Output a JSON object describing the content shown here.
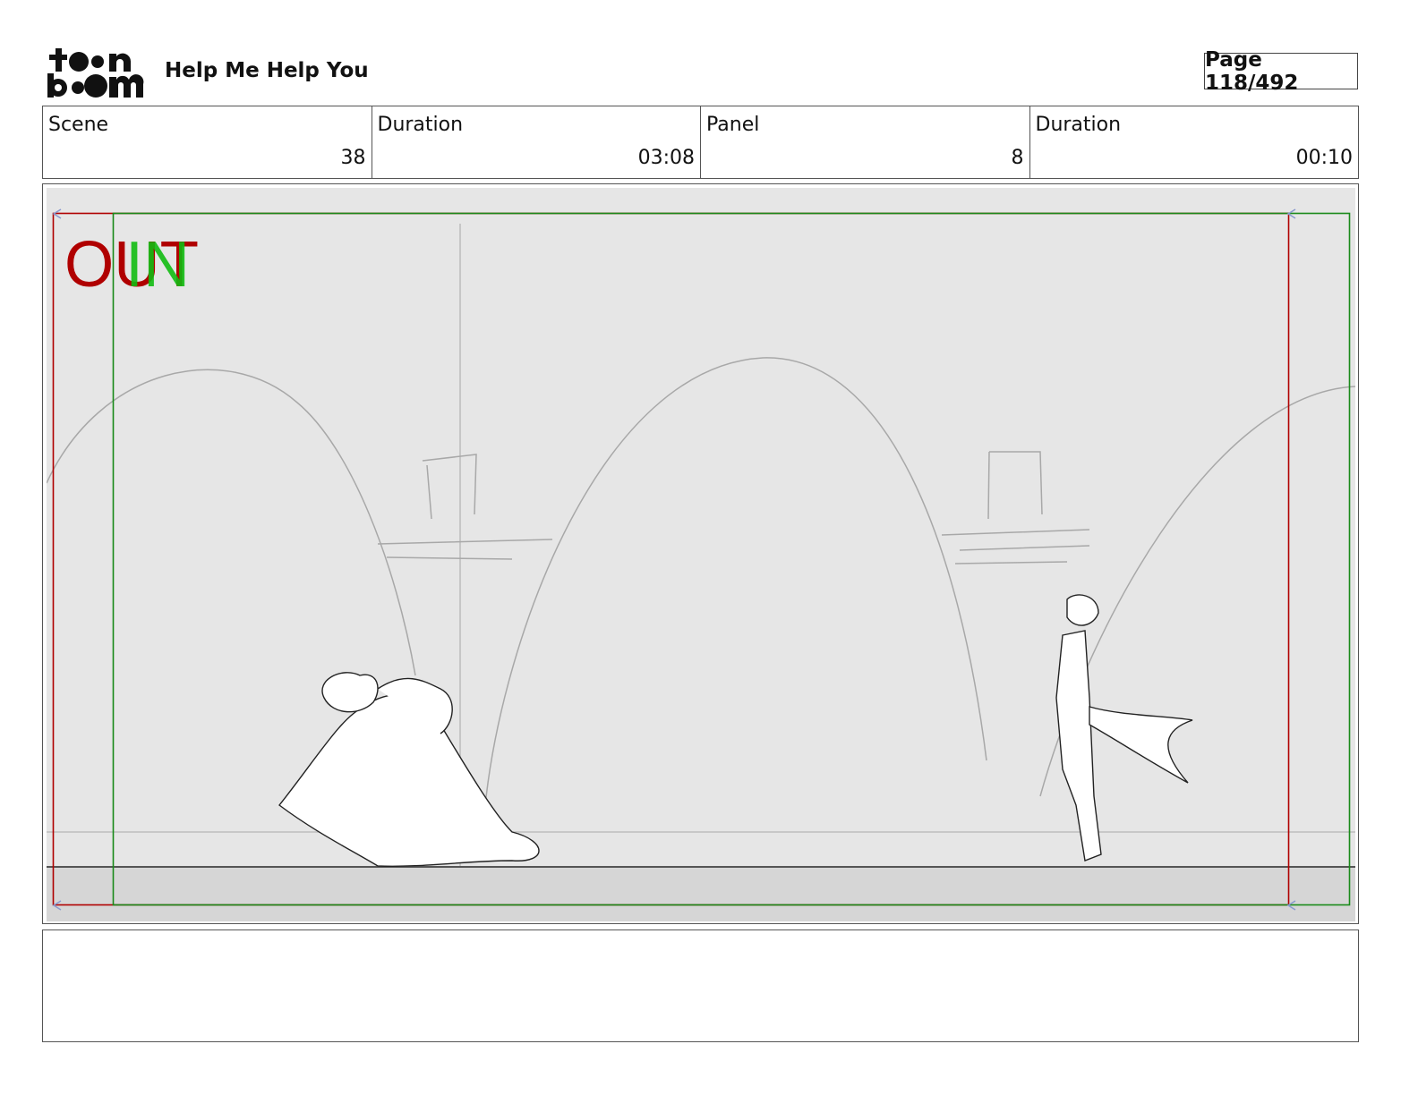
{
  "header": {
    "logo_text": "toon boom",
    "project_title": "Help Me Help You",
    "page_label": "Page 118/492"
  },
  "info": [
    {
      "label": "Scene",
      "value": "38"
    },
    {
      "label": "Duration",
      "value": "03:08"
    },
    {
      "label": "Panel",
      "value": "8"
    },
    {
      "label": "Duration",
      "value": "00:10"
    }
  ],
  "panel": {
    "out_label": "OUT",
    "in_label": "IN",
    "colors": {
      "out_frame": "#b00000",
      "in_frame": "#1a8a1a",
      "in_text": "#11bb11",
      "background": "#e6e6e6"
    }
  },
  "notes": {
    "text": ""
  }
}
